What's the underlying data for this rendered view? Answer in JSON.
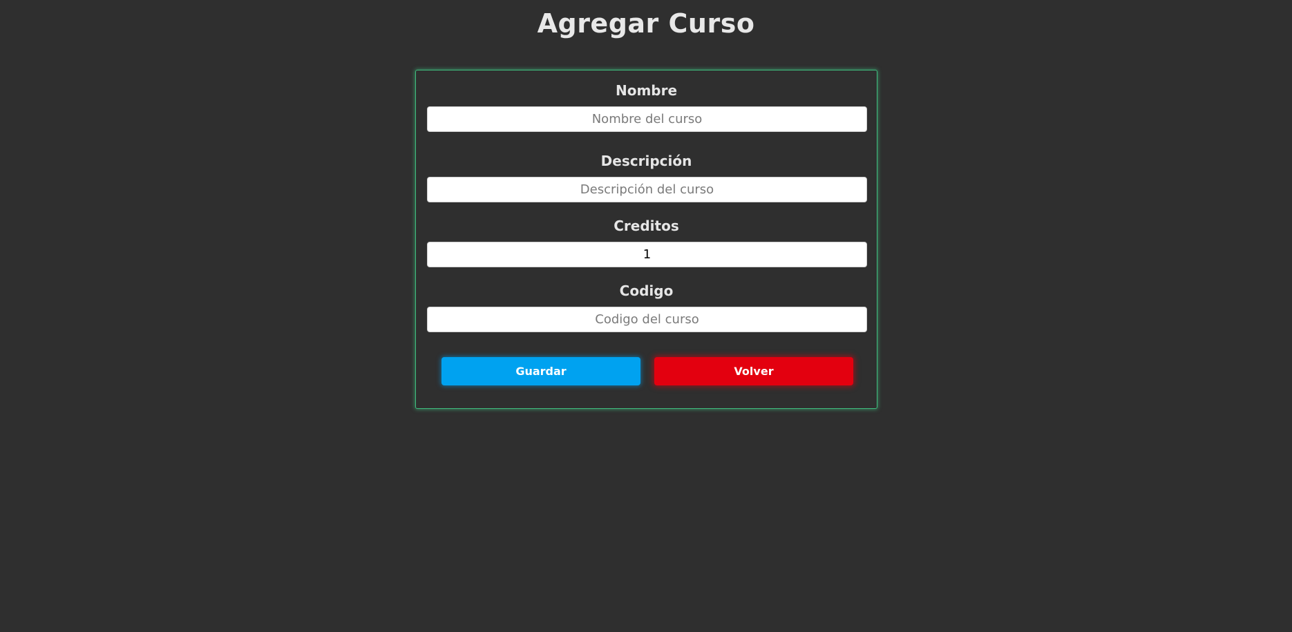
{
  "page": {
    "title": "Agregar Curso"
  },
  "form": {
    "fields": [
      {
        "label": "Nombre",
        "placeholder": "Nombre del curso",
        "value": ""
      },
      {
        "label": "Descripción",
        "placeholder": "Descripción del curso",
        "value": ""
      },
      {
        "label": "Creditos",
        "placeholder": "",
        "value": "1"
      },
      {
        "label": "Codigo",
        "placeholder": "Codigo del curso",
        "value": ""
      }
    ],
    "buttons": {
      "save_label": "Guardar",
      "back_label": "Volver"
    }
  },
  "colors": {
    "background": "#2f2f2f",
    "card_border": "#3fbf7f",
    "save_button": "#00a2f0",
    "back_button": "#e3000f"
  }
}
